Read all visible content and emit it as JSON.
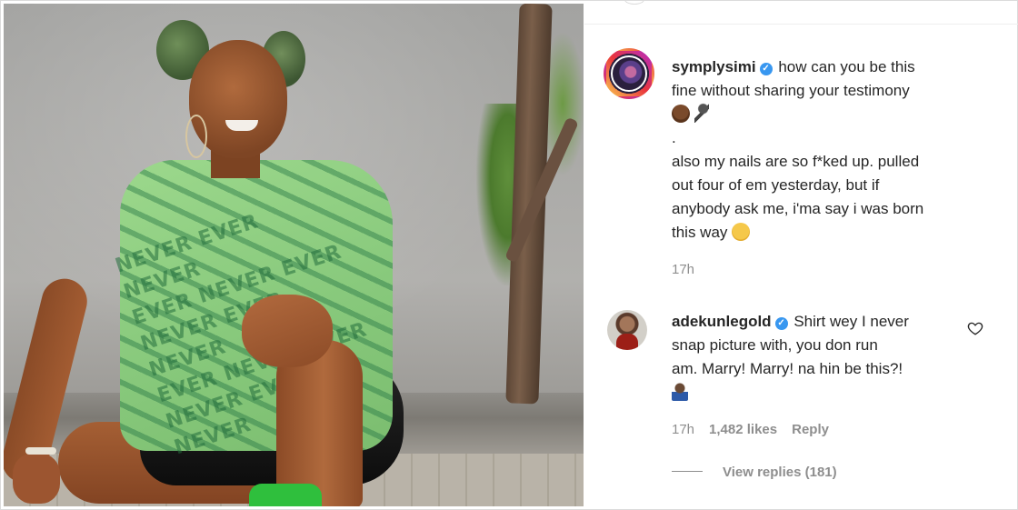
{
  "post": {
    "image_alt": "photo"
  },
  "comments": [
    {
      "username": "symplysimi",
      "verified": true,
      "text_lines": [
        "how can you be this",
        "fine without sharing your testimony",
        "",
        ".",
        "also my nails are so f*ked up. pulled",
        "out four of em yesterday, but if",
        "anybody ask me, i'ma say i was born",
        "this way"
      ],
      "time": "17h"
    },
    {
      "username": "adekunlegold",
      "verified": true,
      "text_lines": [
        "Shirt wey I never",
        "snap picture with, you don run",
        "am. Marry! Marry! na hin be this?!"
      ],
      "time": "17h",
      "likes": "1,482 likes",
      "reply_label": "Reply",
      "view_replies": "View replies (181)"
    }
  ],
  "icons": {
    "verified": "verified-badge-icon",
    "heart": "heart-icon"
  },
  "colors": {
    "verified": "#3897f0",
    "meta": "#8e8e8e",
    "text": "#262626"
  }
}
